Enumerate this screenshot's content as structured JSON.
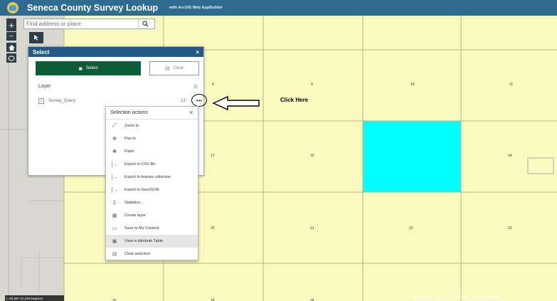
{
  "header": {
    "title": "Seneca County Survey Lookup",
    "subtitle": "with ArcGIS Web AppBuilder"
  },
  "search": {
    "placeholder": "Find address or place"
  },
  "zoom": {
    "in": "+",
    "out": "−"
  },
  "select_panel": {
    "title": "Select",
    "close": "×",
    "select_label": "Select",
    "clear_label": "Clear",
    "layer_label": "Layer",
    "layer_name": "Survey_Query",
    "layer_count": "13",
    "more": "•••"
  },
  "menu": {
    "title": "Selection actions",
    "close": "✕",
    "items": [
      {
        "label": "Zoom to",
        "icon": "zoom-icon"
      },
      {
        "label": "Pan to",
        "icon": "pan-icon"
      },
      {
        "label": "Flash",
        "icon": "flash-icon"
      },
      {
        "label": "Export to CSV file",
        "icon": "export-icon"
      },
      {
        "label": "Export to feature collection",
        "icon": "export-icon"
      },
      {
        "label": "Export to GeoJSON",
        "icon": "export-icon"
      },
      {
        "label": "Statistics...",
        "icon": "sigma-icon"
      },
      {
        "label": "Create layer",
        "icon": "layer-icon"
      },
      {
        "label": "Save to My Content",
        "icon": "save-icon"
      },
      {
        "label": "View in Attribute Table",
        "icon": "table-icon"
      },
      {
        "label": "Clear selection",
        "icon": "clear-icon"
      }
    ]
  },
  "annotation": {
    "click_here": "Click Here"
  },
  "parcels": {
    "r1": [
      "8",
      "9",
      "10",
      "11"
    ],
    "r2": [
      "17",
      "16",
      "14"
    ],
    "r3": [
      "20",
      "21",
      "22",
      "23"
    ],
    "r4": [
      "29",
      "28",
      "26"
    ]
  },
  "coords": "( -83.387 41.228 Degrees",
  "attribution": "Esri, NASA, NGA, USGS, FEMA | Esri Community",
  "colors": {
    "header": "#2f6a8f",
    "parcel_fill": "#fafac0",
    "selected_parcel": "#00ffff",
    "select_button": "#0c5a39"
  }
}
